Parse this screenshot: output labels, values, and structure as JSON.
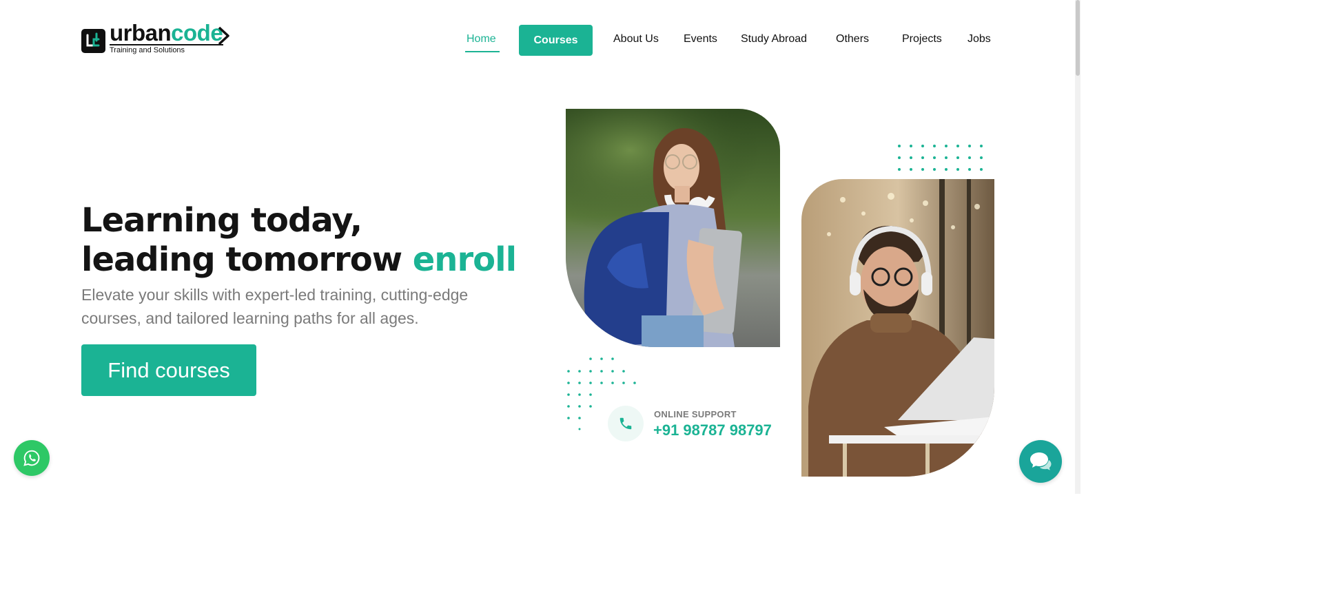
{
  "brand": {
    "name_part1": "urban",
    "name_part2": "code",
    "tagline": "Training and Solutions",
    "accent_color": "#1bb394"
  },
  "nav": {
    "home": "Home",
    "courses": "Courses",
    "about": "About Us",
    "events": "Events",
    "study_abroad": "Study Abroad",
    "others": "Others",
    "projects": "Projects",
    "jobs": "Jobs"
  },
  "hero": {
    "title_line1": "Learning today,",
    "title_line2": "leading tomorrow",
    "title_accent": "enroll",
    "subtitle": "Elevate your skills with expert-led training, cutting-edge courses, and tailored learning paths for all ages.",
    "cta": "Find courses"
  },
  "support": {
    "label": "ONLINE SUPPORT",
    "phone": "+91 98787 98797",
    "icon": "phone-icon"
  },
  "floating": {
    "whatsapp_icon": "whatsapp-icon",
    "whatsapp_color": "#2ec866",
    "chat_icon": "chat-bubbles-icon",
    "chat_color": "#1aa59a"
  }
}
